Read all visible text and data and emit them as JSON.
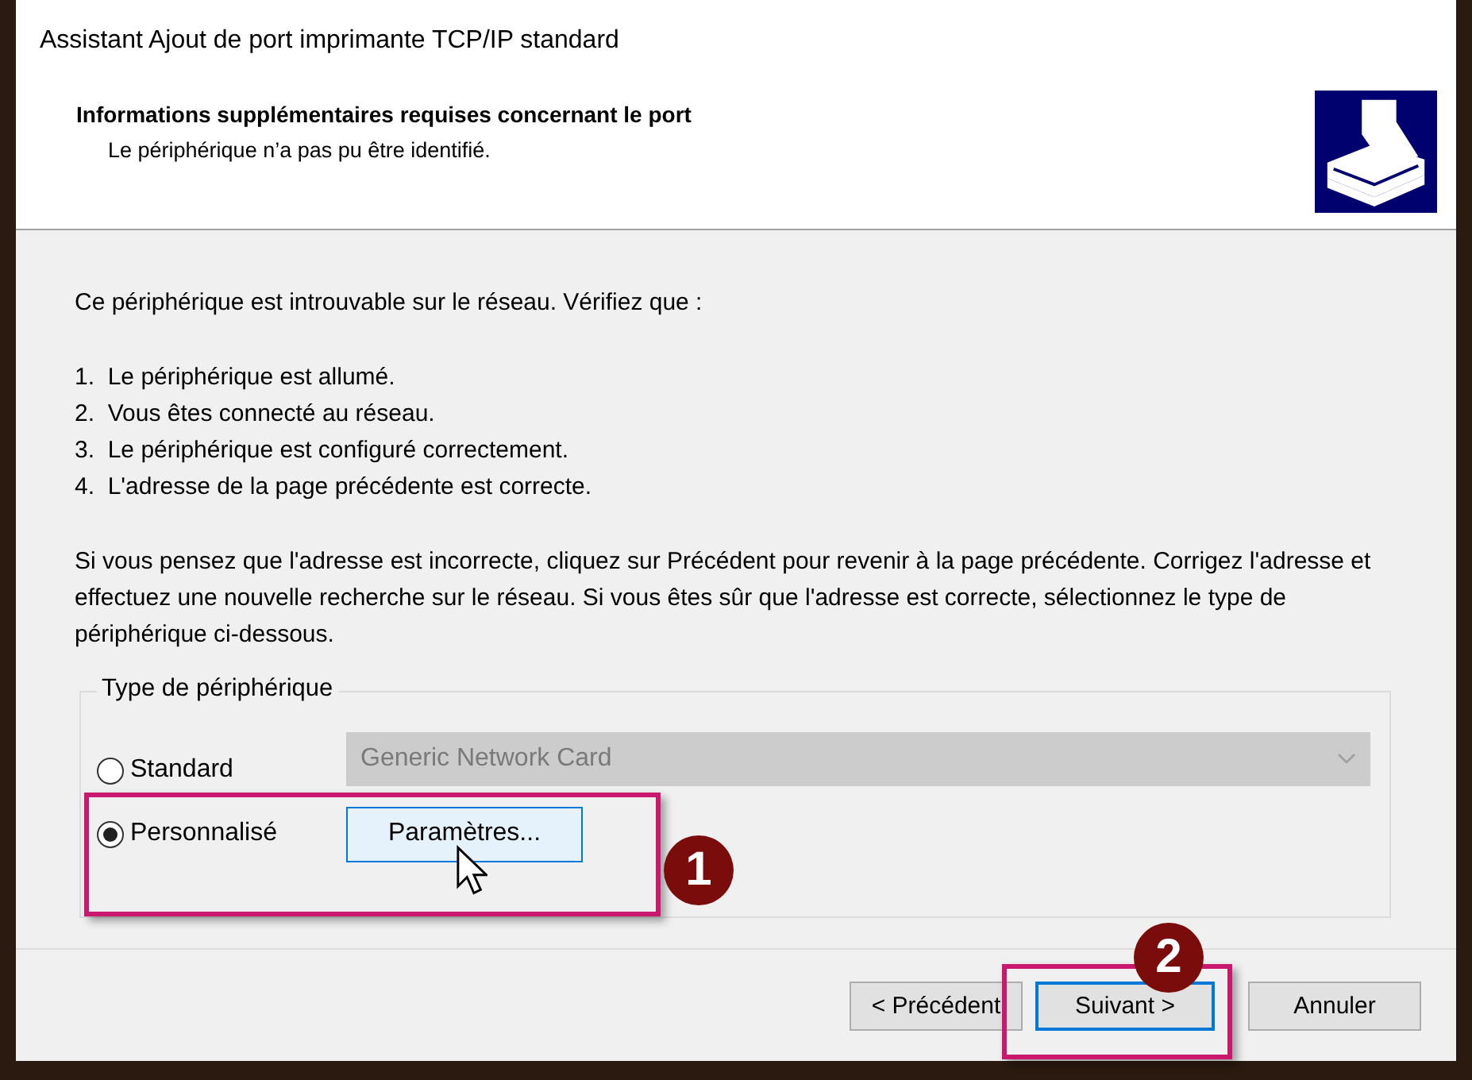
{
  "window": {
    "title": "Assistant Ajout de port imprimante TCP/IP standard"
  },
  "header": {
    "heading": "Informations supplémentaires requises concernant le port",
    "subheading": "Le périphérique n’a pas pu être identifié."
  },
  "body": {
    "intro": "Ce périphérique est introuvable sur le réseau. Vérifiez que :",
    "checklist": [
      "1.  Le périphérique est allumé.",
      "2.  Vous êtes connecté au réseau.",
      "3.  Le périphérique est configuré correctement.",
      "4.  L'adresse de la page précédente est correcte."
    ],
    "instructions": "Si vous pensez que l'adresse est incorrecte, cliquez sur Précédent pour revenir à la page précédente. Corrigez l'adresse et effectuez une nouvelle recherche sur le réseau. Si vous êtes sûr que l'adresse est correcte, sélectionnez le type de périphérique ci-dessous."
  },
  "device_type": {
    "legend": "Type de périphérique",
    "options": [
      {
        "label": "Standard",
        "selected": false,
        "kind": "combo",
        "value": "Generic Network Card",
        "disabled": true
      },
      {
        "label": "Personnalisé",
        "selected": true,
        "kind": "button",
        "button": "Paramètres..."
      }
    ]
  },
  "buttons": [
    {
      "label": "< Précédent",
      "focused": false
    },
    {
      "label": "Suivant >",
      "focused": true
    },
    {
      "label": "Annuler",
      "focused": false
    }
  ],
  "annotations": [
    {
      "number": "1"
    },
    {
      "number": "2"
    }
  ]
}
